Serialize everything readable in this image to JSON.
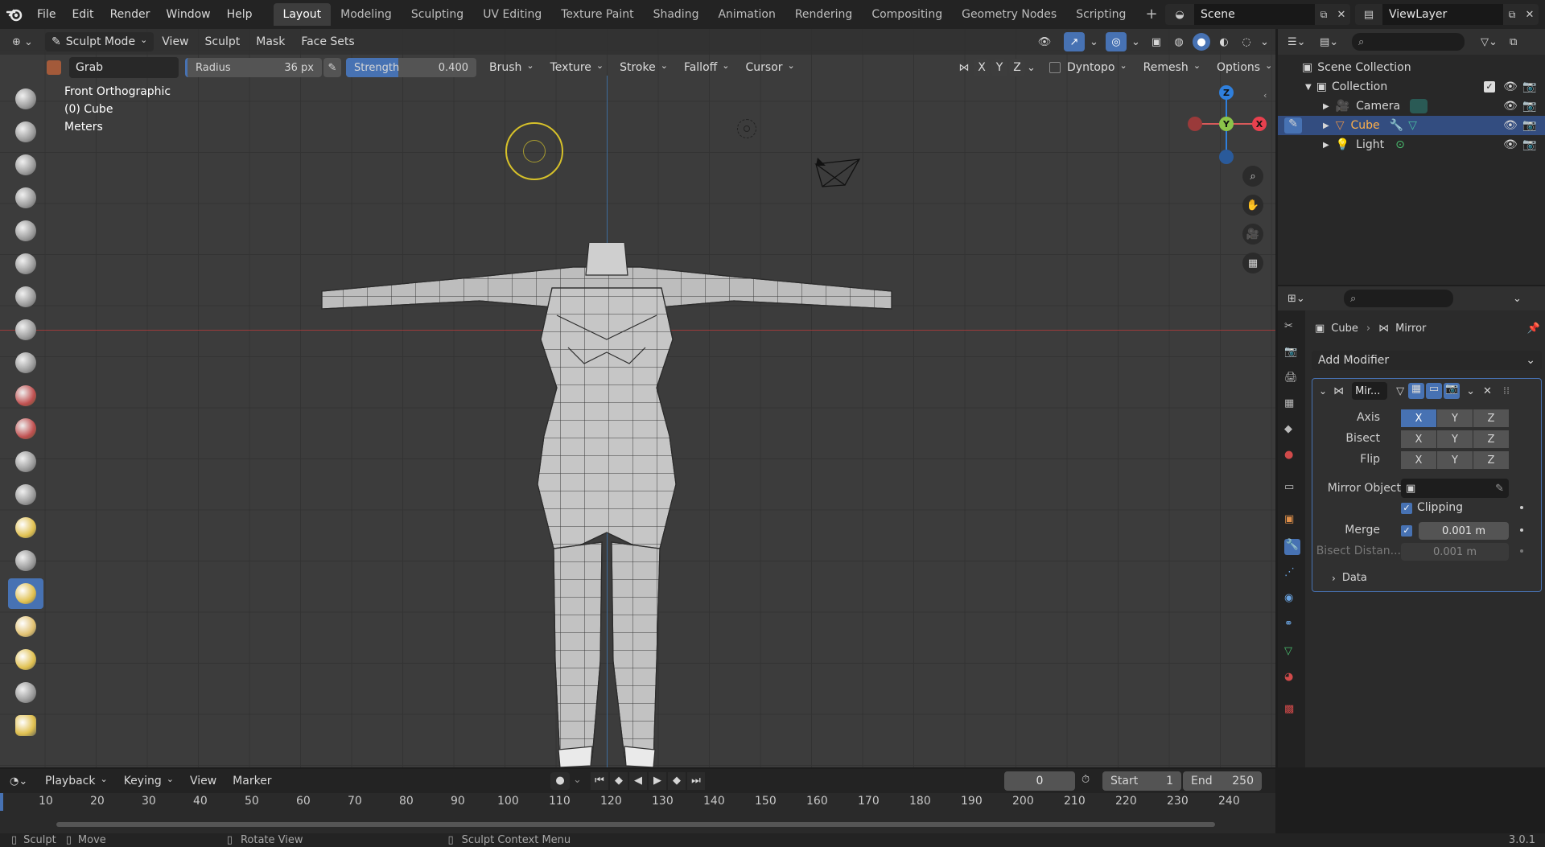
{
  "menu": {
    "items": [
      "File",
      "Edit",
      "Render",
      "Window",
      "Help"
    ],
    "workspaces": [
      "Layout",
      "Modeling",
      "Sculpting",
      "UV Editing",
      "Texture Paint",
      "Shading",
      "Animation",
      "Rendering",
      "Compositing",
      "Geometry Nodes",
      "Scripting"
    ],
    "active_workspace": "Layout",
    "scene": "Scene",
    "view_layer": "ViewLayer"
  },
  "viewport_header": {
    "mode": "Sculpt Mode",
    "menus": [
      "View",
      "Sculpt",
      "Mask",
      "Face Sets"
    ]
  },
  "tool_settings": {
    "brush_name": "Grab",
    "radius_label": "Radius",
    "radius_value": "36 px",
    "strength_label": "Strength",
    "strength_value": "0.400",
    "strength_fraction": 0.4,
    "dropdowns": [
      "Brush",
      "Texture",
      "Stroke",
      "Falloff",
      "Cursor"
    ],
    "symmetry": [
      "X",
      "Y",
      "Z"
    ],
    "right_dropdowns": [
      "Dyntopo",
      "Remesh",
      "Options"
    ]
  },
  "overlay_text": {
    "view": "Front Orthographic",
    "object": "(0) Cube",
    "units": "Meters"
  },
  "outliner": {
    "root": "Scene Collection",
    "collection": "Collection",
    "items": [
      "Camera",
      "Cube",
      "Light"
    ],
    "selected": "Cube"
  },
  "properties": {
    "breadcrumb_object": "Cube",
    "breadcrumb_modifier": "Mirror",
    "add_modifier": "Add Modifier",
    "modifier_name": "Mir...",
    "axis_label": "Axis",
    "bisect_label": "Bisect",
    "flip_label": "Flip",
    "xyz": [
      "X",
      "Y",
      "Z"
    ],
    "mirror_object_label": "Mirror Object",
    "clipping_label": "Clipping",
    "merge_label": "Merge",
    "merge_value": "0.001 m",
    "bisect_distance_label": "Bisect Distan...",
    "bisect_distance_value": "0.001 m",
    "data_label": "Data"
  },
  "timeline": {
    "menus": [
      "Playback",
      "Keying",
      "View",
      "Marker"
    ],
    "current_frame": "0",
    "start_label": "Start",
    "start_value": "1",
    "end_label": "End",
    "end_value": "250",
    "ruler": [
      "10",
      "20",
      "30",
      "40",
      "50",
      "60",
      "70",
      "80",
      "90",
      "100",
      "110",
      "120",
      "130",
      "140",
      "150",
      "160",
      "170",
      "180",
      "190",
      "200",
      "210",
      "220",
      "230",
      "240"
    ]
  },
  "statusbar": {
    "left_action": "Sculpt",
    "middle_action": "Move",
    "rotate_action": "Rotate View",
    "context_menu": "Sculpt Context Menu",
    "version": "3.0.1"
  },
  "colors": {
    "accent": "#4772b3",
    "selection": "#334d80",
    "axis_x": "#e8404e",
    "axis_y": "#8bc34a",
    "axis_z": "#2f7fdc"
  }
}
